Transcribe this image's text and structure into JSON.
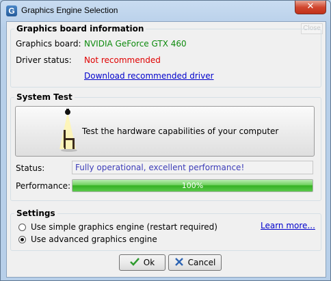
{
  "window": {
    "title": "Graphics Engine Selection",
    "close_glyph": "✕",
    "ghost_close_label": "Close",
    "app_icon_letter": "G"
  },
  "board_info": {
    "legend": "Graphics board information",
    "board_label": "Graphics board:",
    "board_value": "NVIDIA GeForce GTX 460",
    "driver_label": "Driver status:",
    "driver_value": "Not recommended",
    "download_link": "Download recommended driver"
  },
  "system_test": {
    "legend": "System Test",
    "test_button_label": "Test the hardware capabilities of your computer",
    "status_label": "Status:",
    "status_value": "Fully operational, excellent performance!",
    "performance_label": "Performance:",
    "performance_percent": 100,
    "performance_text": "100%"
  },
  "settings": {
    "legend": "Settings",
    "options": [
      {
        "label": "Use simple graphics engine (restart required)",
        "selected": false
      },
      {
        "label": "Use advanced graphics engine",
        "selected": true
      }
    ],
    "learn_more": "Learn more..."
  },
  "buttons": {
    "ok_label": "Ok",
    "cancel_label": "Cancel"
  },
  "icons": {
    "app": "app-logo-icon",
    "test": "lamp-chair-icon",
    "ok": "checkmark-icon",
    "cancel": "x-cross-icon"
  },
  "colors": {
    "board_value": "#0d8a0d",
    "driver_warning": "#e00000",
    "link": "#0000cc",
    "status_text": "#3c3cb8",
    "progress_fill": "#35b123"
  }
}
